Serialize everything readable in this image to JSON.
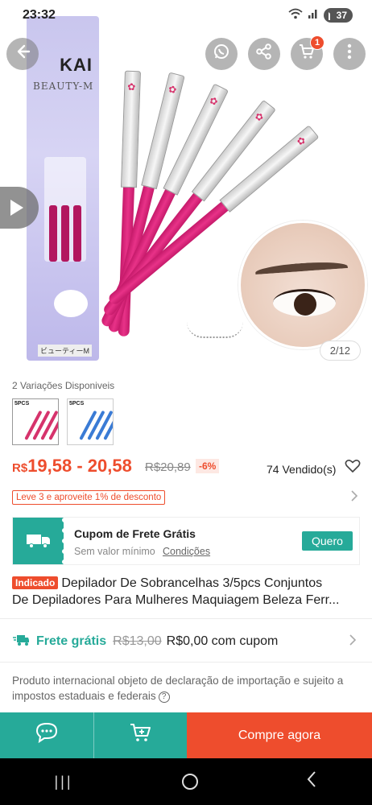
{
  "status_bar": {
    "time": "23:32",
    "signal_icons": [
      "wifi-icon",
      "signal-icon"
    ],
    "battery": "37"
  },
  "hero": {
    "image_counter": "2/12",
    "box_logo": "KAI",
    "box_brand": "BEAUTY-M",
    "box_label": "ビューティーM"
  },
  "top_actions": {
    "back_icon": "arrow-left-icon",
    "whatsapp_icon": "whatsapp-icon",
    "share_icon": "share-icon",
    "cart_icon": "cart-icon",
    "cart_badge": "1",
    "more_icon": "more-vertical-icon"
  },
  "variations": {
    "title": "2 Variações Disponiveis",
    "items": [
      {
        "label": "5PCS",
        "color": "#d6336c"
      },
      {
        "label": "5PCS",
        "color": "#3a7bd5"
      }
    ]
  },
  "price": {
    "currency": "R$",
    "range": "19,58 - 20,58",
    "old": "R$20,89",
    "discount": "-6%",
    "sold": "74 Vendido(s)"
  },
  "promo": {
    "text": "Leve 3 e aproveite 1% de desconto"
  },
  "coupon": {
    "title": "Cupom de Frete Grátis",
    "subtitle": "Sem valor mínimo",
    "link": "Condições",
    "button": "Quero"
  },
  "product": {
    "badge": "Indicado",
    "title_line1": "Depilador De Sobrancelhas 3/5pcs Conjuntos",
    "title_line2": "De Depiladores Para Mulheres Maquiagem Beleza Ferr..."
  },
  "shipping": {
    "label": "Frete grátis",
    "old": "R$13,00",
    "new": "R$0,00 com cupom"
  },
  "notice": {
    "text": "Produto internacional objeto de declaração de importação e sujeito a impostos estaduais e federais"
  },
  "action_bar": {
    "buy_label": "Compre agora"
  },
  "colors": {
    "shopee_orange": "#ee4d2d",
    "teal": "#26aa99",
    "pink": "#e83288"
  }
}
